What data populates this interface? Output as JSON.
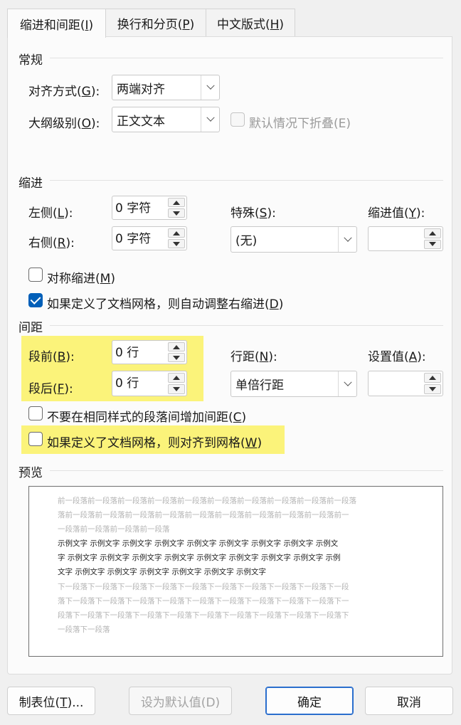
{
  "tabs": [
    {
      "label": "缩进和间距(",
      "key": "I",
      "tail": ")"
    },
    {
      "label": "换行和分页(",
      "key": "P",
      "tail": ")"
    },
    {
      "label": "中文版式(",
      "key": "H",
      "tail": ")"
    }
  ],
  "general": {
    "title": "常规",
    "alignment": {
      "label": "对齐方式(",
      "key": "G",
      "tail": "):",
      "value": "两端对齐"
    },
    "outline": {
      "label": "大纲级别(",
      "key": "O",
      "tail": "):",
      "value": "正文文本"
    },
    "collapse": {
      "label": "默认情况下折叠(E)",
      "checked": false,
      "disabled": true
    }
  },
  "indent": {
    "title": "缩进",
    "left": {
      "label": "左侧(",
      "key": "L",
      "tail": "):",
      "value": "0 字符"
    },
    "right": {
      "label": "右侧(",
      "key": "R",
      "tail": "):",
      "value": "0 字符"
    },
    "special": {
      "label": "特殊(",
      "key": "S",
      "tail": "):",
      "value": "(无)"
    },
    "by": {
      "label": "缩进值(",
      "key": "Y",
      "tail": "):",
      "value": ""
    },
    "mirror": {
      "label": "对称缩进(",
      "key": "M",
      "tail": ")",
      "checked": false
    },
    "auto_adjust": {
      "label": "如果定义了文档网格，则自动调整右缩进(",
      "key": "D",
      "tail": ")",
      "checked": true
    }
  },
  "spacing": {
    "title": "间距",
    "before": {
      "label": "段前(",
      "key": "B",
      "tail": "):",
      "value": "0 行"
    },
    "after": {
      "label": "段后(",
      "key": "F",
      "tail": "):",
      "value": "0 行"
    },
    "line": {
      "label": "行距(",
      "key": "N",
      "tail": "):",
      "value": "单倍行距"
    },
    "at": {
      "label": "设置值(",
      "key": "A",
      "tail": "):",
      "value": ""
    },
    "no_space": {
      "label": "不要在相同样式的段落间增加间距(",
      "key": "C",
      "tail": ")",
      "checked": false
    },
    "snap_grid": {
      "label": "如果定义了文档网格，则对齐到网格(",
      "key": "W",
      "tail": ")",
      "checked": false
    },
    "highlight_color": "#fbf37a"
  },
  "preview": {
    "title": "预览",
    "prev_lines": [
      "前一段落前一段落前一段落前一段落前一段落前一段落前一段落前一段落前一段落前一段落",
      "落前一段落前一段落前一段落前一段落前一段落前一段落前一段落前一段落前一段落前一",
      "一段落前一段落前一段落前一段落"
    ],
    "sample_lines": [
      "示例文字  示例文字  示例文字  示例文字  示例文字  示例文字  示例文字  示例文字  示例文",
      "字  示例文字  示例文字  示例文字  示例文字  示例文字  示例文字  示例文字  示例文字  示例",
      "文字  示例文字  示例文字  示例文字  示例文字  示例文字  示例文字"
    ],
    "next_lines": [
      "下一段落下一段落下一段落下一段落下一段落下一段落下一段落下一段落下一段落下一段",
      "落下一段落下一段落下一段落下一段落下一段落下一段落下一段落下一段落下一段落下一",
      "段落下一段落下一段落下一段落下一段落下一段落下一段落下一段落下一段落下一段落下",
      "一段落下一段落"
    ]
  },
  "buttons": {
    "tabs": {
      "label": "制表位(",
      "key": "T",
      "tail": ")..."
    },
    "set_default": "设为默认值(D)",
    "ok": "确定",
    "cancel": "取消"
  },
  "colors": {
    "accent": "#005fb8",
    "highlight": "#fbf37a"
  }
}
